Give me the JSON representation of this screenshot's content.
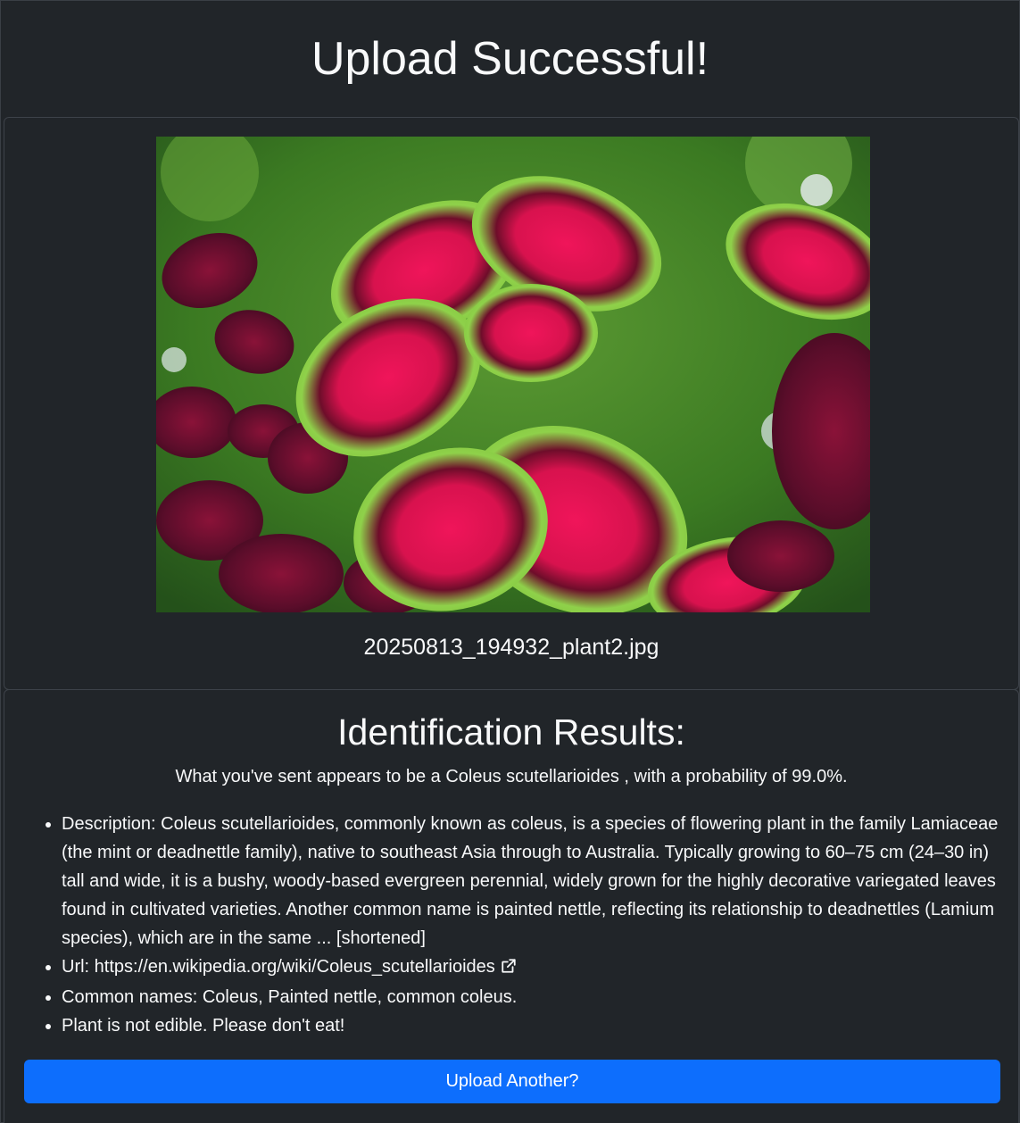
{
  "page": {
    "title": "Upload Successful!"
  },
  "upload": {
    "image_alt": "Uploaded plant photo",
    "filename": "20250813_194932_plant2.jpg"
  },
  "results": {
    "heading": "Identification Results:",
    "summary": "What you've sent appears to be a Coleus scutellarioides , with a probability of 99.0%.",
    "description": "Description: Coleus scutellarioides, commonly known as coleus, is a species of flowering plant in the family Lamiaceae (the mint or deadnettle family), native to southeast Asia through to Australia. Typically growing to 60–75 cm (24–30 in) tall and wide, it is a bushy, woody-based evergreen perennial, widely grown for the highly decorative variegated leaves found in cultivated varieties. Another common name is painted nettle, reflecting its relationship to deadnettles (Lamium species), which are in the same ... [shortened]",
    "url_label": "Url: ",
    "url": "https://en.wikipedia.org/wiki/Coleus_scutellarioides",
    "url_icon": "external-link-icon",
    "common_names": "Common names: Coleus, Painted nettle, common coleus.",
    "edibility": "Plant is not edible. Please don't eat!"
  },
  "actions": {
    "upload_another": "Upload Another?"
  },
  "colors": {
    "background": "#212529",
    "text": "#f8f9fa",
    "border": "#3d4249",
    "primary_button": "#0d6efd"
  }
}
